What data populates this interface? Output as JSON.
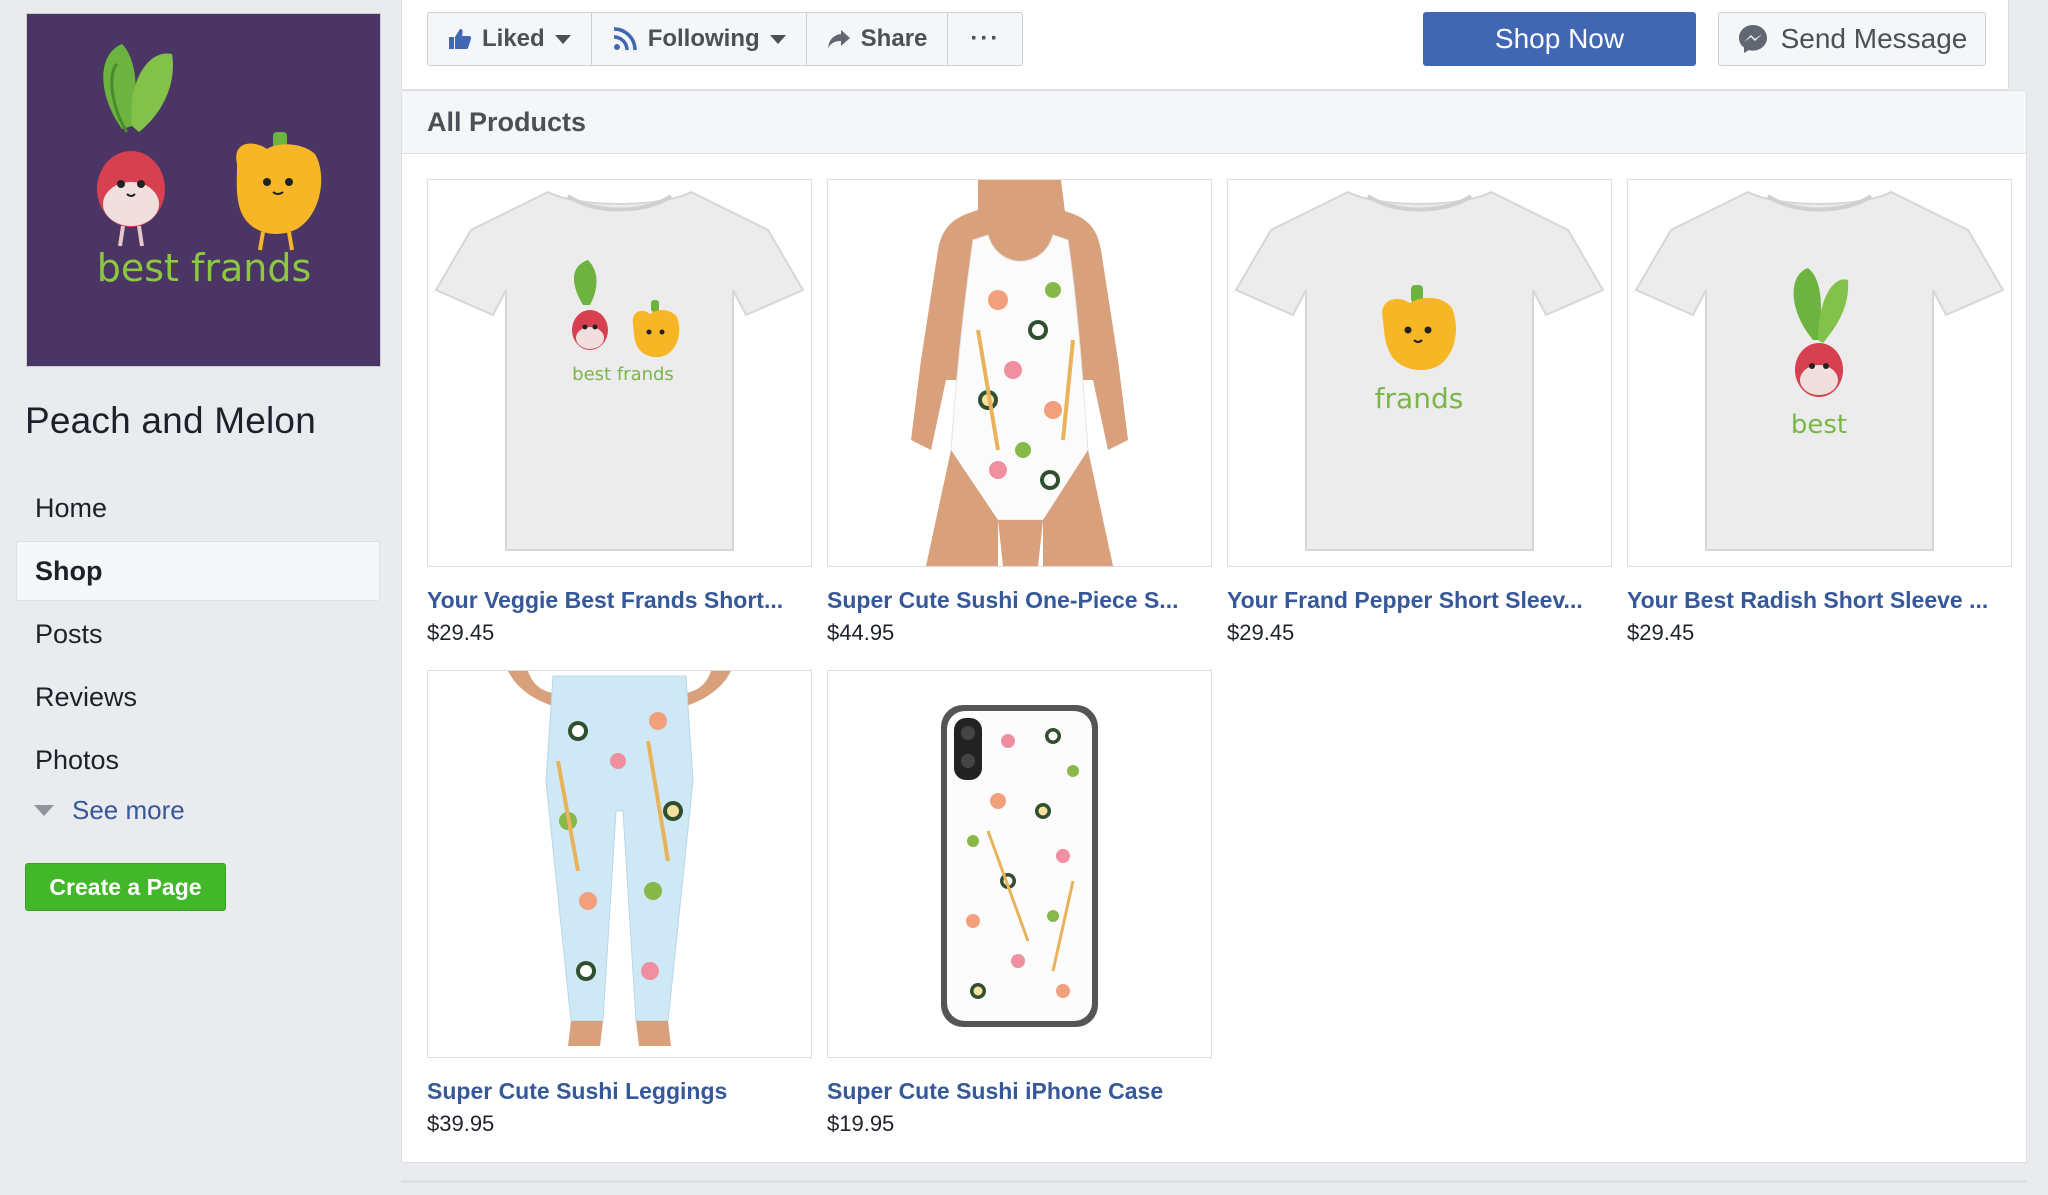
{
  "page": {
    "name": "Peach and Melon",
    "profile_text": "best frands"
  },
  "colors": {
    "brand_blue": "#4267b2",
    "link_blue": "#365899",
    "create_green": "#42b72a",
    "background": "#e9ebee",
    "profile_purple": "#4a3564"
  },
  "nav": {
    "items": [
      {
        "label": "Home",
        "active": false
      },
      {
        "label": "Shop",
        "active": true
      },
      {
        "label": "Posts",
        "active": false
      },
      {
        "label": "Reviews",
        "active": false
      },
      {
        "label": "Photos",
        "active": false
      }
    ],
    "see_more": "See more",
    "create_page": "Create a Page"
  },
  "actions": {
    "liked": "Liked",
    "following": "Following",
    "share": "Share",
    "more": "···",
    "shop_now": "Shop Now",
    "send_message": "Send Message"
  },
  "section": {
    "title": "All Products"
  },
  "products": [
    {
      "title": "Your Veggie Best Frands Short...",
      "price": "$29.45",
      "image": "tshirt-best-frands",
      "shirt_text": "best frands"
    },
    {
      "title": "Super Cute Sushi One-Piece S...",
      "price": "$44.95",
      "image": "sushi-swimsuit"
    },
    {
      "title": "Your Frand Pepper Short Sleev...",
      "price": "$29.45",
      "image": "tshirt-pepper",
      "shirt_text": "frands"
    },
    {
      "title": "Your Best Radish Short Sleeve ...",
      "price": "$29.45",
      "image": "tshirt-radish",
      "shirt_text": "best"
    },
    {
      "title": "Super Cute Sushi Leggings",
      "price": "$39.95",
      "image": "sushi-leggings"
    },
    {
      "title": "Super Cute Sushi iPhone Case",
      "price": "$19.95",
      "image": "sushi-phone-case"
    }
  ]
}
